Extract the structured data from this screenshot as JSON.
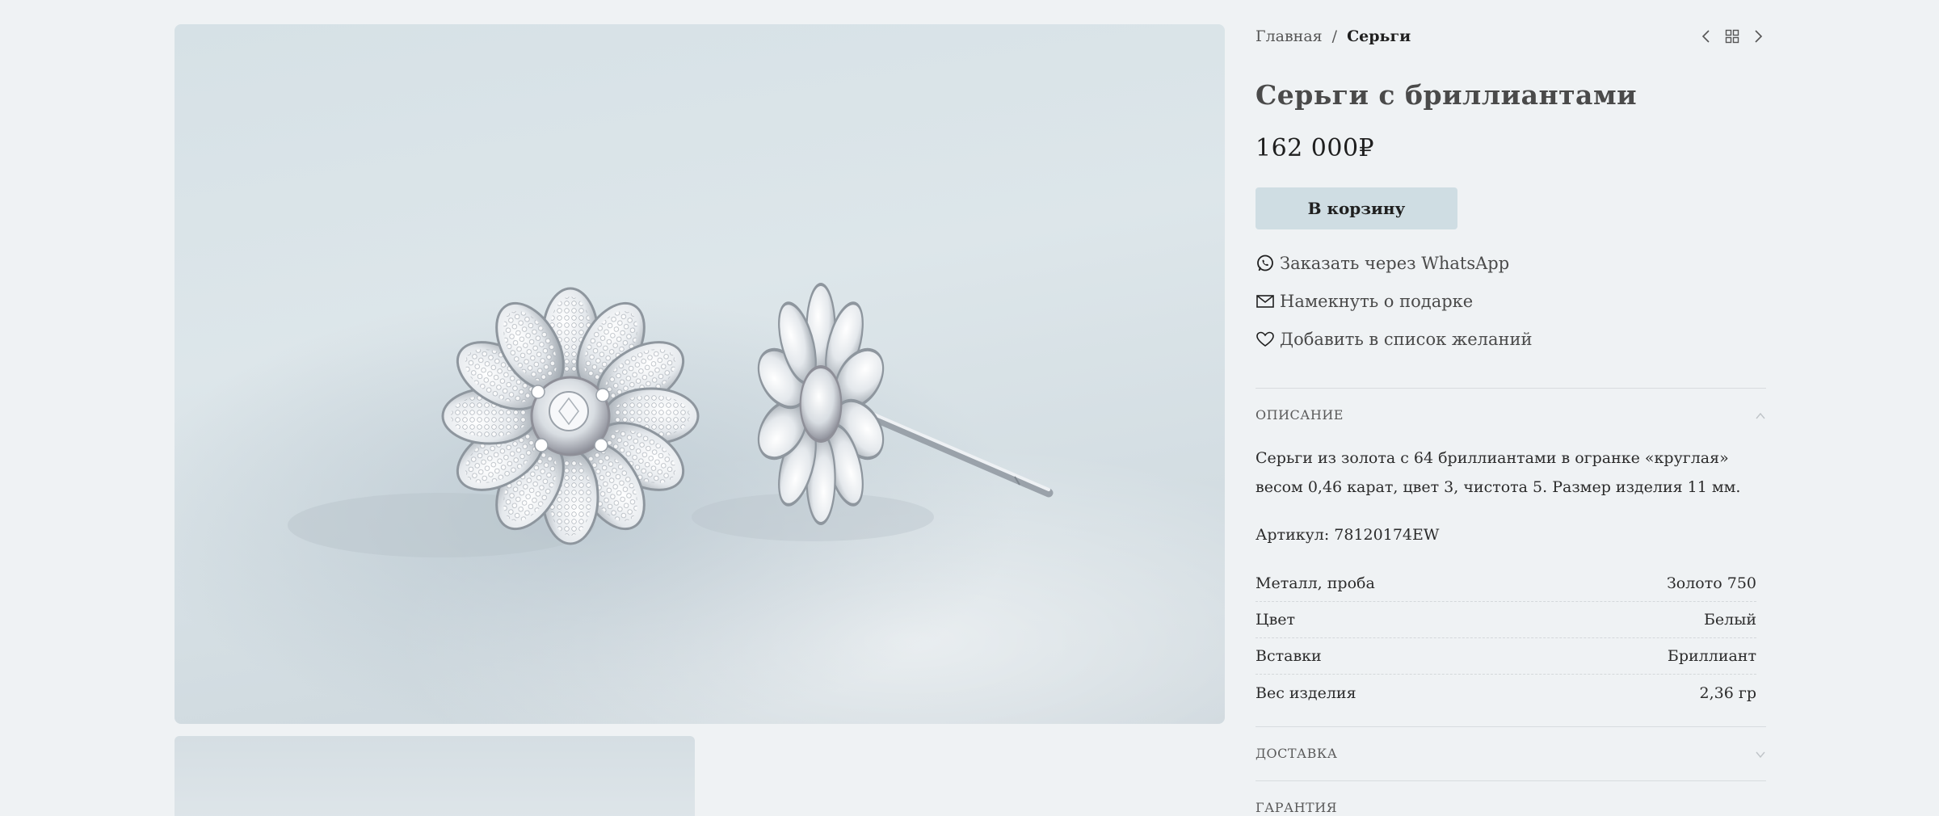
{
  "gallery": {
    "main_photo_alt": "",
    "thumbnail_alt": ""
  },
  "breadcrumb": {
    "home": "Главная",
    "separator": "/",
    "current": "Серьги"
  },
  "navigation_icons": [
    "chevron-left-icon",
    "grid-icon",
    "chevron-right-icon"
  ],
  "product": {
    "title": "Серьги с бриллиантами",
    "price": "162 000₽",
    "cart_button": "В корзину"
  },
  "actions": [
    {
      "icon": "whatsapp-icon",
      "label": "Заказать через WhatsApp"
    },
    {
      "icon": "envelope-icon",
      "label": "Намекнуть о подарке"
    },
    {
      "icon": "heart-icon",
      "label": "Добавить в список желаний"
    }
  ],
  "sections": {
    "description": {
      "heading": "ОПИСАНИЕ",
      "expanded": true,
      "text": "Серьги из золота с 64 бриллиантами в огранке «круглая» весом 0,46 карат, цвет 3, чистота 5. Размер изделия 11 мм.",
      "sku": "Артикул: 78120174EW",
      "specs": [
        {
          "label": "Металл, проба",
          "value": "Золото 750"
        },
        {
          "label": "Цвет",
          "value": "Белый"
        },
        {
          "label": "Вставки",
          "value": "Бриллиант"
        },
        {
          "label": "Вес изделия",
          "value": "2,36 гр"
        }
      ]
    },
    "delivery": {
      "heading": "ДОСТАВКА",
      "expanded": false
    },
    "warranty": {
      "heading": "ГАРАНТИЯ",
      "expanded": false
    }
  },
  "colors": {
    "background": "#eff2f4",
    "cart_button": "#cfdde3",
    "photo_backdrop": "#d6e1e6"
  }
}
